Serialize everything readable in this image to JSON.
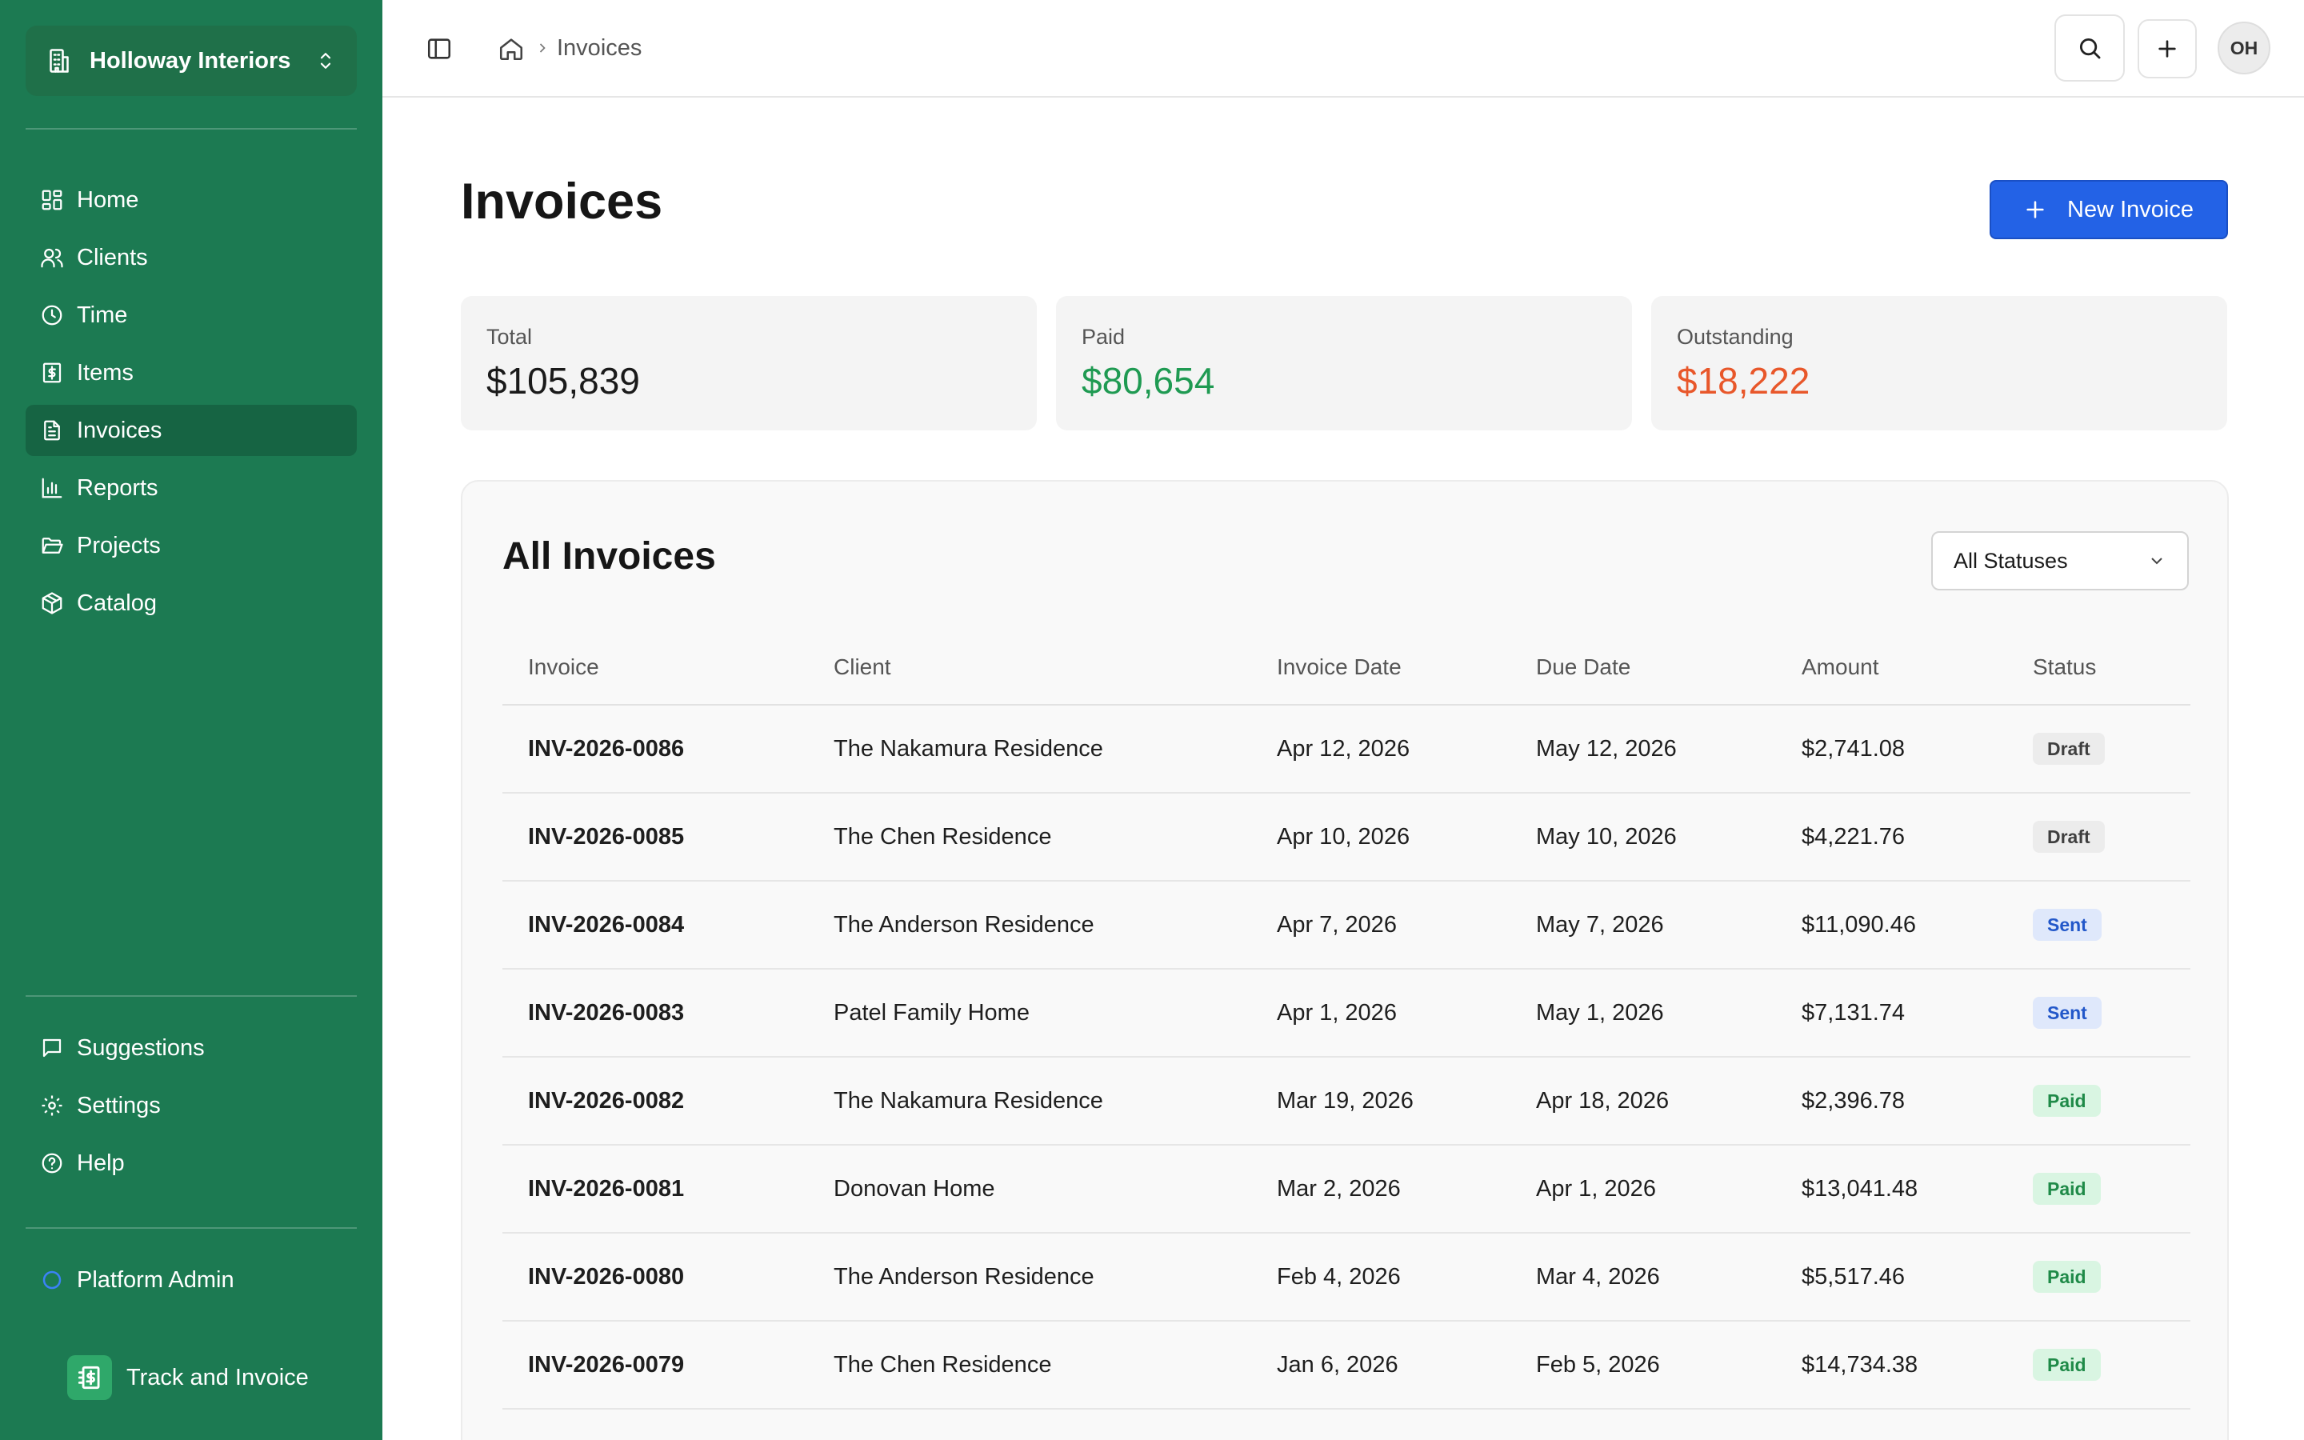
{
  "org": {
    "name": "Holloway Interiors"
  },
  "nav": {
    "primary": [
      {
        "label": "Home",
        "icon": "grid-icon"
      },
      {
        "label": "Clients",
        "icon": "users-icon"
      },
      {
        "label": "Time",
        "icon": "clock-icon"
      },
      {
        "label": "Items",
        "icon": "receipt-icon"
      },
      {
        "label": "Invoices",
        "icon": "file-text-icon",
        "active": true
      },
      {
        "label": "Reports",
        "icon": "bar-chart-icon"
      },
      {
        "label": "Projects",
        "icon": "folder-icon"
      },
      {
        "label": "Catalog",
        "icon": "package-icon"
      }
    ],
    "secondary": [
      {
        "label": "Suggestions",
        "icon": "message-icon"
      },
      {
        "label": "Settings",
        "icon": "gear-icon"
      },
      {
        "label": "Help",
        "icon": "help-circle-icon"
      }
    ],
    "admin": {
      "label": "Platform Admin",
      "icon": "circle-icon"
    },
    "brand": {
      "label": "Track and Invoice"
    }
  },
  "topbar": {
    "breadcrumb": "Invoices",
    "avatar_initials": "OH"
  },
  "page": {
    "title": "Invoices",
    "new_button": "New Invoice"
  },
  "stats": {
    "total": {
      "label": "Total",
      "value": "$105,839"
    },
    "paid": {
      "label": "Paid",
      "value": "$80,654"
    },
    "outstanding": {
      "label": "Outstanding",
      "value": "$18,222"
    }
  },
  "colors": {
    "sidebar": "#1c7a52",
    "accent": "#2362e6",
    "paid": "#1f9a52",
    "outstanding": "#e8572a"
  },
  "table": {
    "title": "All Invoices",
    "filter": "All Statuses",
    "columns": [
      "Invoice",
      "Client",
      "Invoice Date",
      "Due Date",
      "Amount",
      "Status"
    ],
    "rows": [
      {
        "invoice": "INV-2026-0086",
        "client": "The Nakamura Residence",
        "date": "Apr 12, 2026",
        "due": "May 12, 2026",
        "amount": "$2,741.08",
        "status": "Draft"
      },
      {
        "invoice": "INV-2026-0085",
        "client": "The Chen Residence",
        "date": "Apr 10, 2026",
        "due": "May 10, 2026",
        "amount": "$4,221.76",
        "status": "Draft"
      },
      {
        "invoice": "INV-2026-0084",
        "client": "The Anderson Residence",
        "date": "Apr 7, 2026",
        "due": "May 7, 2026",
        "amount": "$11,090.46",
        "status": "Sent"
      },
      {
        "invoice": "INV-2026-0083",
        "client": "Patel Family Home",
        "date": "Apr 1, 2026",
        "due": "May 1, 2026",
        "amount": "$7,131.74",
        "status": "Sent"
      },
      {
        "invoice": "INV-2026-0082",
        "client": "The Nakamura Residence",
        "date": "Mar 19, 2026",
        "due": "Apr 18, 2026",
        "amount": "$2,396.78",
        "status": "Paid"
      },
      {
        "invoice": "INV-2026-0081",
        "client": "Donovan Home",
        "date": "Mar 2, 2026",
        "due": "Apr 1, 2026",
        "amount": "$13,041.48",
        "status": "Paid"
      },
      {
        "invoice": "INV-2026-0080",
        "client": "The Anderson Residence",
        "date": "Feb 4, 2026",
        "due": "Mar 4, 2026",
        "amount": "$5,517.46",
        "status": "Paid"
      },
      {
        "invoice": "INV-2026-0079",
        "client": "The Chen Residence",
        "date": "Jan 6, 2026",
        "due": "Feb 5, 2026",
        "amount": "$14,734.38",
        "status": "Paid"
      }
    ]
  }
}
